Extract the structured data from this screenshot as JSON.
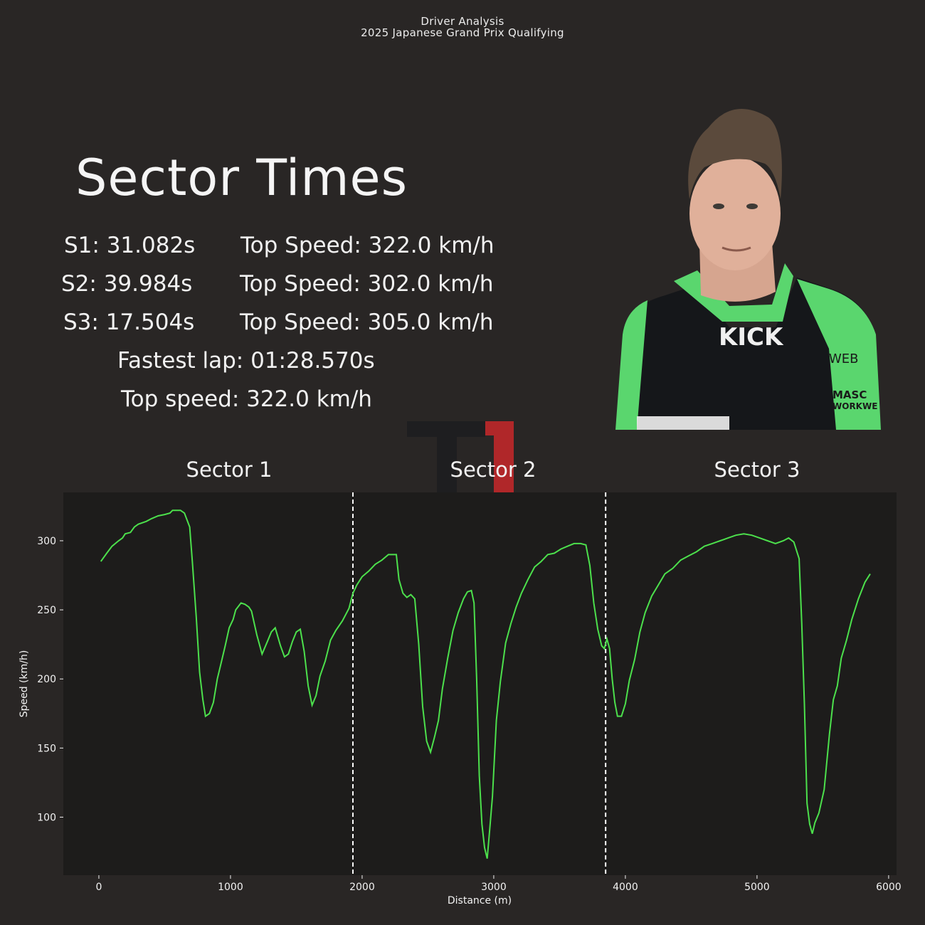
{
  "header": {
    "line1": "Driver Analysis",
    "line2": "2025 Japanese Grand Prix Qualifying"
  },
  "stats": {
    "title": "Sector Times",
    "s1": "S1: 31.082s",
    "s1_speed": "Top Speed: 322.0 km/h",
    "s2": "S2: 39.984s",
    "s2_speed": "Top Speed: 302.0 km/h",
    "s3": "S3: 17.504s",
    "s3_speed": "Top Speed: 305.0 km/h",
    "fastest_lap": "Fastest lap: 01:28.570s",
    "top_speed": "Top speed: 322.0 km/h"
  },
  "colors": {
    "background": "#292625",
    "plot_bg": "#1d1c1b",
    "line": "#4ce04c",
    "sector_line": "#ffffff",
    "suit_green": "#5ad66e",
    "f1_red": "#c8282a"
  },
  "chart_data": {
    "type": "line",
    "title": "",
    "xlabel": "Distance (m)",
    "ylabel": "Speed (km/h)",
    "xlim": [
      -270,
      6060
    ],
    "ylim": [
      58,
      335
    ],
    "xticks": [
      0,
      1000,
      2000,
      3000,
      4000,
      5000,
      6000
    ],
    "yticks": [
      100,
      150,
      200,
      250,
      300
    ],
    "grid": false,
    "sector_boundaries": [
      1930,
      3850
    ],
    "sector_labels": [
      "Sector 1",
      "Sector 2",
      "Sector 3"
    ],
    "series": [
      {
        "color": "#4ce04c",
        "points": [
          [
            15,
            285
          ],
          [
            60,
            291
          ],
          [
            100,
            296
          ],
          [
            150,
            300
          ],
          [
            180,
            302
          ],
          [
            200,
            305
          ],
          [
            240,
            306
          ],
          [
            270,
            310
          ],
          [
            300,
            312
          ],
          [
            360,
            314
          ],
          [
            400,
            316
          ],
          [
            450,
            318
          ],
          [
            500,
            319
          ],
          [
            540,
            320
          ],
          [
            560,
            322
          ],
          [
            620,
            322
          ],
          [
            650,
            320
          ],
          [
            690,
            310
          ],
          [
            710,
            285
          ],
          [
            740,
            245
          ],
          [
            765,
            205
          ],
          [
            790,
            185
          ],
          [
            810,
            173
          ],
          [
            840,
            175
          ],
          [
            870,
            183
          ],
          [
            900,
            200
          ],
          [
            930,
            212
          ],
          [
            960,
            224
          ],
          [
            990,
            237
          ],
          [
            1020,
            243
          ],
          [
            1040,
            250
          ],
          [
            1080,
            255
          ],
          [
            1110,
            254
          ],
          [
            1140,
            252
          ],
          [
            1160,
            249
          ],
          [
            1200,
            232
          ],
          [
            1240,
            218
          ],
          [
            1280,
            227
          ],
          [
            1310,
            234
          ],
          [
            1340,
            237
          ],
          [
            1380,
            224
          ],
          [
            1410,
            216
          ],
          [
            1440,
            218
          ],
          [
            1470,
            227
          ],
          [
            1500,
            234
          ],
          [
            1530,
            236
          ],
          [
            1560,
            220
          ],
          [
            1590,
            195
          ],
          [
            1620,
            181
          ],
          [
            1650,
            188
          ],
          [
            1680,
            202
          ],
          [
            1720,
            213
          ],
          [
            1760,
            228
          ],
          [
            1800,
            235
          ],
          [
            1850,
            242
          ],
          [
            1900,
            251
          ],
          [
            1930,
            262
          ],
          [
            1960,
            268
          ],
          [
            2000,
            274
          ],
          [
            2050,
            278
          ],
          [
            2100,
            283
          ],
          [
            2150,
            286
          ],
          [
            2200,
            290
          ],
          [
            2260,
            290
          ],
          [
            2280,
            272
          ],
          [
            2310,
            262
          ],
          [
            2340,
            259
          ],
          [
            2370,
            261
          ],
          [
            2400,
            258
          ],
          [
            2430,
            225
          ],
          [
            2460,
            180
          ],
          [
            2490,
            155
          ],
          [
            2520,
            147
          ],
          [
            2550,
            158
          ],
          [
            2580,
            170
          ],
          [
            2610,
            193
          ],
          [
            2650,
            215
          ],
          [
            2690,
            235
          ],
          [
            2730,
            248
          ],
          [
            2770,
            258
          ],
          [
            2800,
            263
          ],
          [
            2830,
            264
          ],
          [
            2850,
            255
          ],
          [
            2870,
            200
          ],
          [
            2890,
            130
          ],
          [
            2910,
            95
          ],
          [
            2930,
            78
          ],
          [
            2950,
            70
          ],
          [
            2970,
            92
          ],
          [
            2990,
            115
          ],
          [
            3020,
            170
          ],
          [
            3050,
            198
          ],
          [
            3090,
            226
          ],
          [
            3130,
            240
          ],
          [
            3170,
            252
          ],
          [
            3210,
            262
          ],
          [
            3260,
            272
          ],
          [
            3310,
            281
          ],
          [
            3360,
            285
          ],
          [
            3410,
            290
          ],
          [
            3460,
            291
          ],
          [
            3510,
            294
          ],
          [
            3560,
            296
          ],
          [
            3610,
            298
          ],
          [
            3660,
            298
          ],
          [
            3700,
            297
          ],
          [
            3730,
            282
          ],
          [
            3760,
            255
          ],
          [
            3790,
            236
          ],
          [
            3820,
            224
          ],
          [
            3840,
            222
          ],
          [
            3860,
            229
          ],
          [
            3880,
            222
          ],
          [
            3900,
            200
          ],
          [
            3920,
            183
          ],
          [
            3940,
            173
          ],
          [
            3970,
            173
          ],
          [
            4000,
            182
          ],
          [
            4030,
            199
          ],
          [
            4070,
            214
          ],
          [
            4110,
            234
          ],
          [
            4150,
            248
          ],
          [
            4200,
            260
          ],
          [
            4250,
            268
          ],
          [
            4300,
            276
          ],
          [
            4360,
            280
          ],
          [
            4420,
            286
          ],
          [
            4480,
            289
          ],
          [
            4540,
            292
          ],
          [
            4600,
            296
          ],
          [
            4660,
            298
          ],
          [
            4720,
            300
          ],
          [
            4780,
            302
          ],
          [
            4840,
            304
          ],
          [
            4900,
            305
          ],
          [
            4960,
            304
          ],
          [
            5020,
            302
          ],
          [
            5080,
            300
          ],
          [
            5140,
            298
          ],
          [
            5200,
            300
          ],
          [
            5240,
            302
          ],
          [
            5280,
            299
          ],
          [
            5320,
            287
          ],
          [
            5340,
            240
          ],
          [
            5360,
            182
          ],
          [
            5380,
            110
          ],
          [
            5400,
            95
          ],
          [
            5420,
            88
          ],
          [
            5440,
            96
          ],
          [
            5470,
            103
          ],
          [
            5510,
            120
          ],
          [
            5550,
            160
          ],
          [
            5580,
            185
          ],
          [
            5610,
            195
          ],
          [
            5640,
            215
          ],
          [
            5680,
            228
          ],
          [
            5720,
            243
          ],
          [
            5770,
            258
          ],
          [
            5820,
            270
          ],
          [
            5860,
            276
          ]
        ]
      }
    ]
  }
}
